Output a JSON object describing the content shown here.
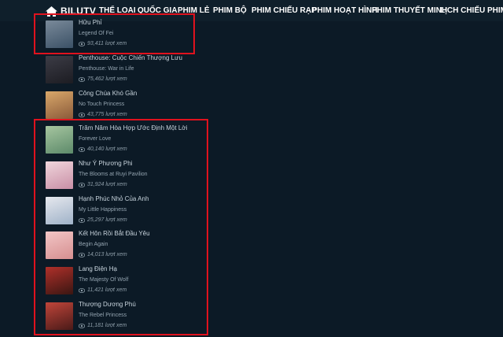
{
  "nav": {
    "logo_text": "BILUTV",
    "items": [
      {
        "label": "THỂ LOẠI"
      },
      {
        "label": "QUỐC GIA"
      },
      {
        "label": "PHIM LẺ"
      },
      {
        "label": "PHIM BỘ"
      },
      {
        "label": "PHIM CHIẾU RẠP"
      },
      {
        "label": "PHIM HOẠT HÌNH"
      },
      {
        "label": "PHIM THUYẾT MINH"
      },
      {
        "label": "LỊCH CHIẾU PHIM"
      }
    ]
  },
  "movies": [
    {
      "title": "Hữu Phỉ",
      "subtitle": "Legend Of Fei",
      "views": "93,411 lượt xem",
      "color_a": "#7a8a9a",
      "color_b": "#3b5166"
    },
    {
      "title": "Penthouse: Cuộc Chiến Thượng Lưu",
      "subtitle": "Penthouse: War in Life",
      "views": "75,462 lượt xem",
      "color_a": "#3c3c46",
      "color_b": "#1c1c22"
    },
    {
      "title": "Công Chúa Khó Gần",
      "subtitle": "No Touch Princess",
      "views": "43,775 lượt xem",
      "color_a": "#d9a86a",
      "color_b": "#8a5a3a"
    },
    {
      "title": "Trăm Năm Hòa Hợp Ước Định Một Lời",
      "subtitle": "Forever Love",
      "views": "40,140 lượt xem",
      "color_a": "#a6c6a0",
      "color_b": "#5d8a6a"
    },
    {
      "title": "Như Ý Phương Phi",
      "subtitle": "The Blooms at Ruyi Pavilion",
      "views": "31,924 lượt xem",
      "color_a": "#f0d6dc",
      "color_b": "#c98fa6"
    },
    {
      "title": "Hạnh Phúc Nhỏ Của Anh",
      "subtitle": "My Little Happiness",
      "views": "25,297 lượt xem",
      "color_a": "#e6e8ee",
      "color_b": "#9fb2c8"
    },
    {
      "title": "Kết Hôn Rồi Bắt Đầu Yêu",
      "subtitle": "Begin Again",
      "views": "14,013 lượt xem",
      "color_a": "#f2c6c6",
      "color_b": "#d68f90"
    },
    {
      "title": "Lang Điện Hạ",
      "subtitle": "The Majesty Of Wolf",
      "views": "11,421 lượt xem",
      "color_a": "#b0302a",
      "color_b": "#3a1612"
    },
    {
      "title": "Thượng Dương Phú",
      "subtitle": "The Rebel Princess",
      "views": "11,181 lượt xem",
      "color_a": "#c0453a",
      "color_b": "#4a1a18"
    }
  ],
  "colors": {
    "highlight": "#e0121e",
    "background": "#0c1a26",
    "navbar": "#0f1f2b"
  }
}
